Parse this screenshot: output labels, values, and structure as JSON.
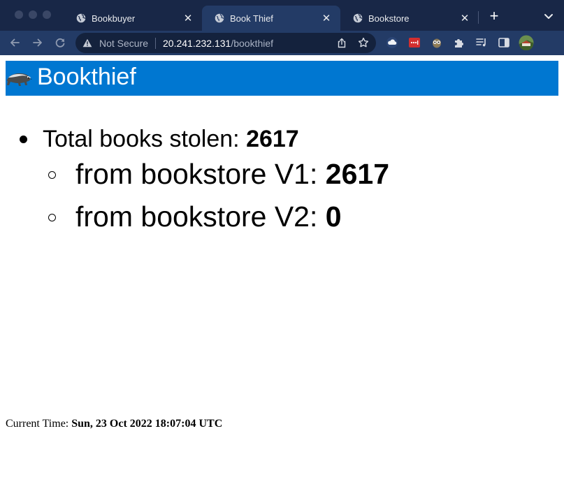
{
  "browser": {
    "tabs": [
      {
        "title": "Bookbuyer",
        "active": false,
        "icon": "globe-icon"
      },
      {
        "title": "Book Thief",
        "active": true,
        "icon": "globe-icon"
      },
      {
        "title": "Bookstore",
        "active": false,
        "icon": "globe-icon"
      }
    ],
    "new_tab_symbol": "+",
    "address": {
      "security_label": "Not Secure",
      "host": "20.241.232.131",
      "path": "/bookthief"
    },
    "colors": {
      "tabstrip": "#182747",
      "toolbar": "#233b66",
      "omnibox": "#14223d"
    }
  },
  "page": {
    "header": {
      "title": "Bookthief",
      "logo": "badger-logo-icon",
      "background": "#0077d1"
    },
    "stats": {
      "total_label": "Total books stolen: ",
      "total_value": "2617",
      "v1_label": "from bookstore V1: ",
      "v1_value": "2617",
      "v2_label": "from bookstore V2: ",
      "v2_value": "0"
    },
    "footer": {
      "time_label": "Current Time: ",
      "time_value": "Sun, 23 Oct 2022 18:07:04 UTC"
    }
  }
}
